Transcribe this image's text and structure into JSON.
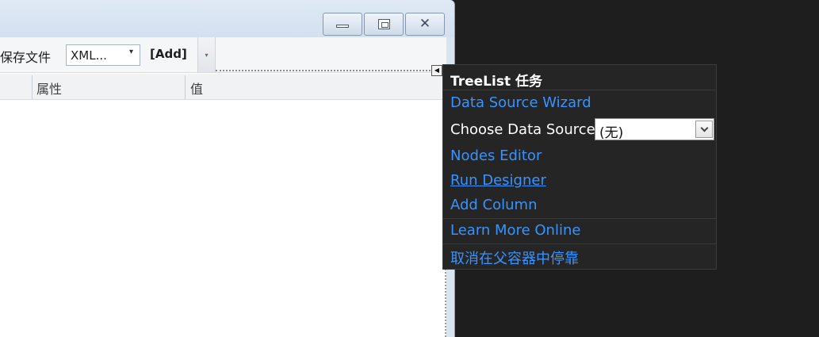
{
  "window": {
    "minimize_icon": "minimize-icon",
    "maximize_icon": "maximize-icon",
    "close_icon": "close-icon",
    "close_glyph": "✕"
  },
  "toolbar": {
    "save_file_label": "保存文件",
    "format_combo_value": "XML...",
    "format_combo_arrow": "▾",
    "add_label": "[Add]",
    "dropdown_arrow": "▾"
  },
  "grid": {
    "columns": [
      "属性",
      "值"
    ]
  },
  "smart_tag": {
    "glyph": "◀"
  },
  "task_panel": {
    "title": "TreeList 任务",
    "data_source_wizard": "Data Source Wizard",
    "choose_data_source_label": "Choose Data Source",
    "data_source_value": "(无)",
    "nodes_editor": "Nodes Editor",
    "run_designer": "Run Designer",
    "add_column": "Add Column",
    "learn_more_online": "Learn More Online",
    "undock": "取消在父容器中停靠"
  },
  "colors": {
    "link": "#3794ff",
    "panel_bg": "#252526",
    "ide_bg": "#1e1e1e"
  }
}
